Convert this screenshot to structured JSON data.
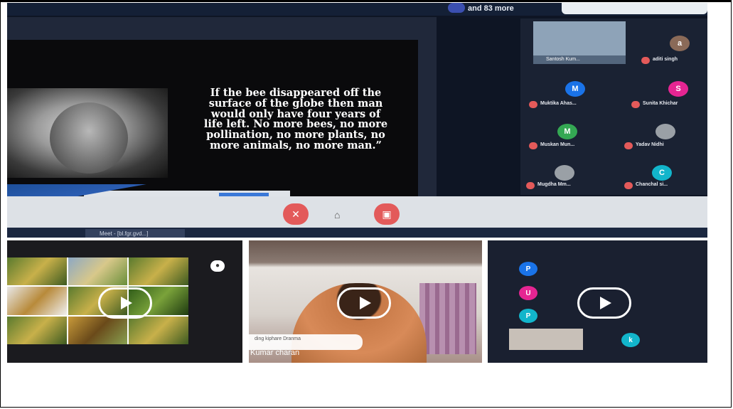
{
  "meeting": {
    "participants_more": "and 83 more",
    "quote": "If the bee disappeared off the surface of the globe then man would only have four years of life left. No more bees, no more pollination, no more plants, no more animals, no more man.”",
    "self_name": "Santosh Kum...",
    "taskbar_item": "Meet - [bl.fgr.gvd...]",
    "participants": [
      {
        "initial": "a",
        "name": "aditi singh",
        "color": "#8a6a58"
      },
      {
        "initial": "M",
        "name": "Muktika Ahas...",
        "color": "#1a73e8"
      },
      {
        "initial": "S",
        "name": "Sunita Khichar",
        "color": "#e52592"
      },
      {
        "initial": "M",
        "name": "Muskan Mun...",
        "color": "#34a853"
      },
      {
        "initial": "",
        "name": "Yadav Nidhi",
        "color": "#9aa0a6"
      },
      {
        "initial": "",
        "name": "Mugdha Mm...",
        "color": "#9aa0a6"
      },
      {
        "initial": "C",
        "name": "Chanchal si...",
        "color": "#12b5cb"
      }
    ]
  },
  "thumbnails": {
    "video2_caption_line": "ding kiphare Dranma",
    "video2_name": "Kumar charan",
    "video3_avatars": [
      "P",
      "U",
      "P",
      "k"
    ]
  },
  "icons": {
    "play": "play-icon",
    "mic_off": "mic-off-icon",
    "camera_off": "camera-off-icon",
    "end_call": "end-call-icon",
    "bell": "bell-icon"
  }
}
